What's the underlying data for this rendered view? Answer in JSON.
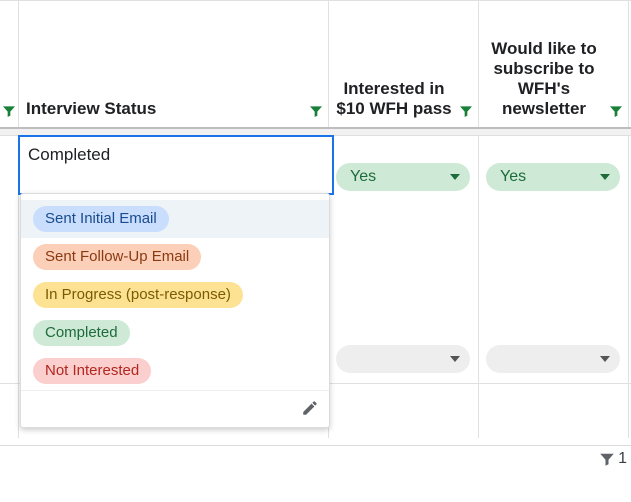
{
  "columns": {
    "interview_status": {
      "label": "Interview Status"
    },
    "pass": {
      "label": "Interested in $10 WFH pass"
    },
    "newsletter": {
      "label": "Would like to subscribe to WFH's newsletter"
    }
  },
  "edit_cell": {
    "value": "Completed"
  },
  "dropdown": {
    "options": [
      {
        "label": "Sent Initial Email",
        "bg": "#c9defc",
        "fg": "#1a4b8e"
      },
      {
        "label": "Sent Follow-Up Email",
        "bg": "#fccfb8",
        "fg": "#8a3a12"
      },
      {
        "label": "In Progress (post-response)",
        "bg": "#fde293",
        "fg": "#7a5c00"
      },
      {
        "label": "Completed",
        "bg": "#ceead6",
        "fg": "#1e6b3a"
      },
      {
        "label": "Not Interested",
        "bg": "#fccfcf",
        "fg": "#b3261e"
      }
    ]
  },
  "rows": {
    "r1": {
      "pass": "Yes",
      "newsletter": "Yes"
    },
    "r2": {
      "pass": "",
      "newsletter": ""
    }
  },
  "footer": {
    "filtered_count": "1"
  }
}
